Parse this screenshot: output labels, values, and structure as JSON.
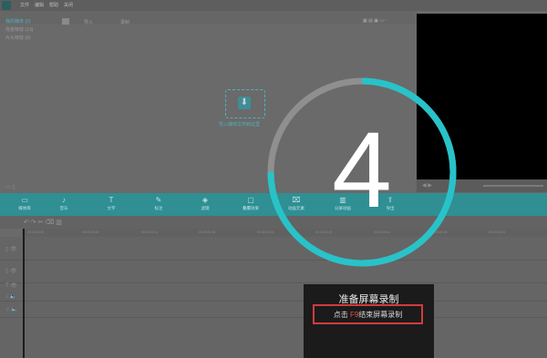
{
  "menu": [
    "文件",
    "编辑",
    "帮助",
    "关闭"
  ],
  "library_header": {
    "import_label": "导入",
    "record_label": "录制"
  },
  "sidebar": {
    "items": [
      "我的媒体 (0)",
      "背景特效 (13)",
      "片头特效 (9)"
    ]
  },
  "import_hint": "导入媒体文件到这里",
  "toolbar": {
    "items": [
      {
        "icon": "folder-icon",
        "glyph": "▭",
        "label": "媒体库"
      },
      {
        "icon": "music-icon",
        "glyph": "♪",
        "label": "音乐"
      },
      {
        "icon": "text-icon",
        "glyph": "T",
        "label": "文字"
      },
      {
        "icon": "pen-icon",
        "glyph": "✎",
        "label": "标注"
      },
      {
        "icon": "filter-icon",
        "glyph": "◈",
        "label": "滤镜"
      },
      {
        "icon": "overlay-icon",
        "glyph": "▢",
        "label": "叠覆效果"
      },
      {
        "icon": "transition-icon",
        "glyph": "⌧",
        "label": "动画元素"
      },
      {
        "icon": "split-icon",
        "glyph": "▥",
        "label": "分屏动画"
      },
      {
        "icon": "export-icon",
        "glyph": "⇪",
        "label": "导出"
      }
    ]
  },
  "ruler": {
    "ticks": [
      "00:00:00:00",
      "00:00:00:20",
      "00:00:01:11",
      "00:00:01:30",
      "00:00:02:01",
      "00:00:02:20",
      "00:00:03:11",
      "00:00:03:30",
      "00:00:04:01",
      "00:00:04:20",
      "00:00:05:11"
    ]
  },
  "countdown": {
    "number": "4",
    "progress": 0.25,
    "ring_color": "#27c3c9",
    "track_color": "#8f8f8f"
  },
  "dialog": {
    "title": "准备屏幕录制",
    "instruction_prefix": "点击 ",
    "hotkey": "F9",
    "instruction_suffix": "结束屏幕录制"
  },
  "colors": {
    "accent": "#2f8f93",
    "highlight": "#d23c3c"
  }
}
